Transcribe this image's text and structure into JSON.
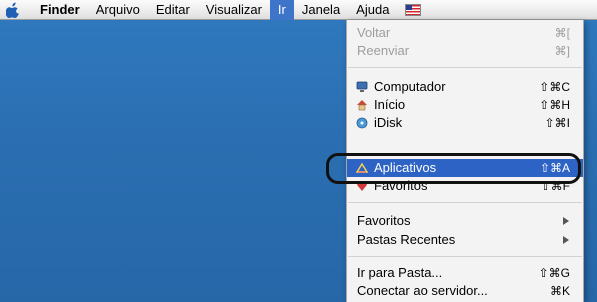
{
  "menubar": {
    "app_name": "Finder",
    "items": [
      "Arquivo",
      "Editar",
      "Visualizar",
      "Ir",
      "Janela",
      "Ajuda"
    ],
    "active_item": "Ir"
  },
  "go_menu": {
    "voltar": {
      "label": "Voltar",
      "shortcut": "⌘["
    },
    "reenviar": {
      "label": "Reenviar",
      "shortcut": "⌘]"
    },
    "computador": {
      "label": "Computador",
      "shortcut": "⇧⌘C"
    },
    "inicio": {
      "label": "Início",
      "shortcut": "⇧⌘H"
    },
    "idisk": {
      "label": "iDisk",
      "shortcut": "⇧⌘I"
    },
    "aplicativos": {
      "label": "Aplicativos",
      "shortcut": "⇧⌘A"
    },
    "favoritos_item": {
      "label": "Favoritos",
      "shortcut": "⇧⌘F"
    },
    "favoritos_sub": {
      "label": "Favoritos"
    },
    "pastas_recentes": {
      "label": "Pastas Recentes"
    },
    "ir_para_pasta": {
      "label": "Ir para Pasta...",
      "shortcut": "⇧⌘G"
    },
    "conectar": {
      "label": "Conectar ao servidor...",
      "shortcut": "⌘K"
    }
  },
  "colors": {
    "desktop": "#2b6fb2",
    "selection": "#2c63c4",
    "menu_background": "#f3f3f3"
  },
  "icons": [
    "apple-icon",
    "us-flag-icon",
    "computer-icon",
    "home-icon",
    "idisk-icon",
    "applications-icon",
    "favorites-heart-icon",
    "submenu-arrow-icon"
  ]
}
